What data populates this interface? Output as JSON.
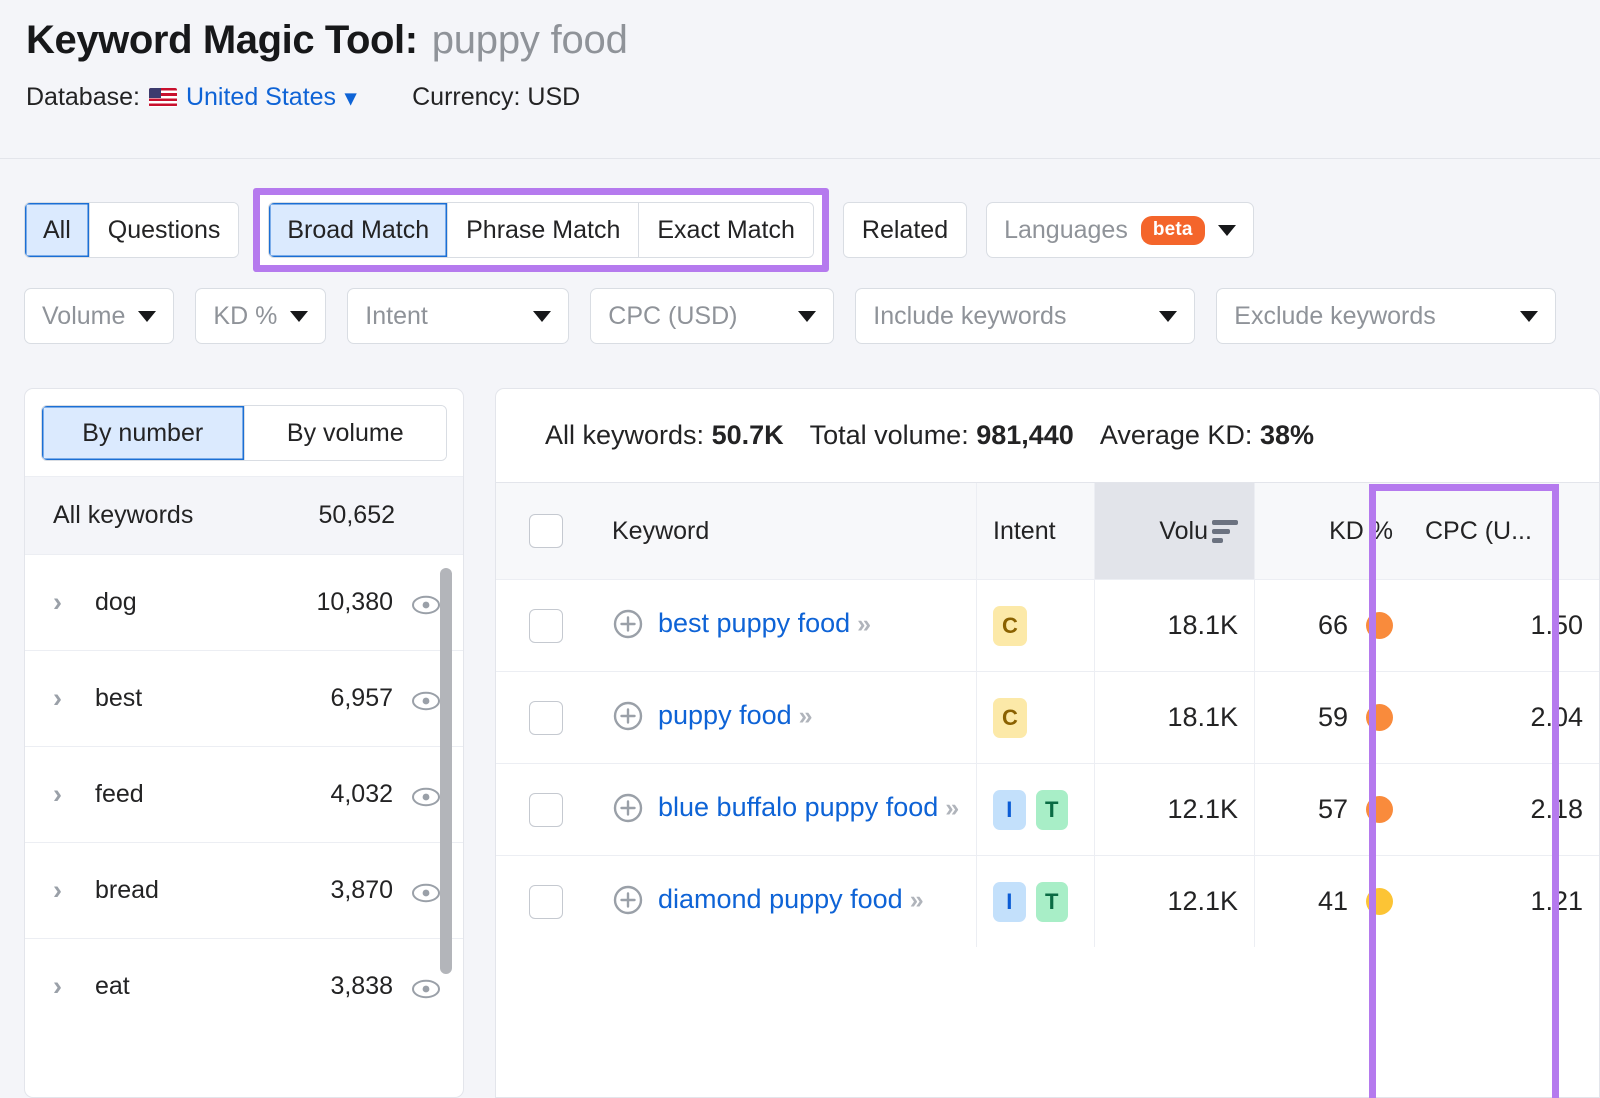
{
  "header": {
    "title_prefix": "Keyword Magic Tool:",
    "query": "puppy food",
    "database_label": "Database:",
    "database_value": "United States",
    "currency_label": "Currency: USD"
  },
  "tabs": {
    "type_tabs": [
      {
        "label": "All",
        "active": true
      },
      {
        "label": "Questions",
        "active": false
      }
    ],
    "match_tabs": [
      {
        "label": "Broad Match",
        "active": true
      },
      {
        "label": "Phrase Match",
        "active": false
      },
      {
        "label": "Exact Match",
        "active": false
      }
    ],
    "related_label": "Related",
    "languages_label": "Languages",
    "languages_badge": "beta"
  },
  "filters": [
    {
      "label": "Volume",
      "muted": true
    },
    {
      "label": "KD %",
      "muted": true
    },
    {
      "label": "Intent",
      "muted": true
    },
    {
      "label": "CPC (USD)",
      "muted": true
    },
    {
      "label": "Include keywords",
      "muted": true
    },
    {
      "label": "Exclude keywords",
      "muted": true
    }
  ],
  "sidebar": {
    "view_tabs": [
      {
        "label": "By number",
        "active": true
      },
      {
        "label": "By volume",
        "active": false
      }
    ],
    "all_row": {
      "label": "All keywords",
      "count": "50,652"
    },
    "groups": [
      {
        "label": "dog",
        "count": "10,380"
      },
      {
        "label": "best",
        "count": "6,957"
      },
      {
        "label": "feed",
        "count": "4,032"
      },
      {
        "label": "bread",
        "count": "3,870"
      },
      {
        "label": "eat",
        "count": "3,838"
      }
    ]
  },
  "summary": {
    "all_keywords_label": "All keywords:",
    "all_keywords_value": "50.7K",
    "total_volume_label": "Total volume:",
    "total_volume_value": "981,440",
    "average_kd_label": "Average KD:",
    "average_kd_value": "38%"
  },
  "table": {
    "columns": {
      "keyword": "Keyword",
      "intent": "Intent",
      "volume": "Volu",
      "kd": "KD %",
      "cpc": "CPC (U..."
    },
    "rows": [
      {
        "keyword": "best puppy food",
        "intents": [
          {
            "code": "C",
            "type": "commercial"
          }
        ],
        "volume": "18.1K",
        "kd": "66",
        "kd_color": "#f98b3c",
        "cpc": "1.50"
      },
      {
        "keyword": "puppy food",
        "intents": [
          {
            "code": "C",
            "type": "commercial"
          }
        ],
        "volume": "18.1K",
        "kd": "59",
        "kd_color": "#f98b3c",
        "cpc": "2.04"
      },
      {
        "keyword": "blue buffalo puppy food",
        "intents": [
          {
            "code": "I",
            "type": "informational"
          },
          {
            "code": "T",
            "type": "transactional"
          }
        ],
        "volume": "12.1K",
        "kd": "57",
        "kd_color": "#f98b3c",
        "cpc": "2.18"
      },
      {
        "keyword": "diamond puppy food",
        "intents": [
          {
            "code": "I",
            "type": "informational"
          },
          {
            "code": "T",
            "type": "transactional"
          }
        ],
        "volume": "12.1K",
        "kd": "41",
        "kd_color": "#fcc435",
        "cpc": "1.21"
      }
    ]
  },
  "colors": {
    "highlight_purple": "#b57aee",
    "link_blue": "#0e63d6",
    "accent_blue": "#1b6fd4",
    "beta_orange": "#f4652b"
  }
}
